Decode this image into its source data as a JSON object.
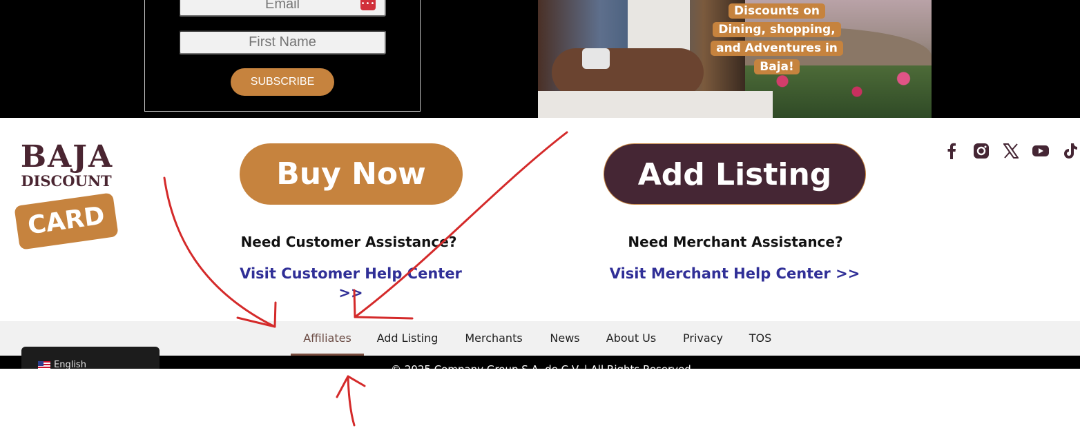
{
  "subscribe": {
    "email_placeholder": "Email",
    "first_name_placeholder": "First Name",
    "button_label": "SUBSCRIBE"
  },
  "promo": {
    "text": "Discounts on Dining, shopping, and Adventures in Baja!"
  },
  "logo": {
    "line1": "BAJA",
    "line2": "DISCOUNT",
    "line3": "CARD"
  },
  "cta": {
    "buy_now": "Buy Now",
    "add_listing": "Add Listing"
  },
  "assistance": {
    "customer_question": "Need Customer Assistance?",
    "customer_link": "Visit Customer Help Center >>",
    "merchant_question": "Need Merchant Assistance?",
    "merchant_link": "Visit Merchant Help Center >>"
  },
  "social": [
    "facebook-icon",
    "instagram-icon",
    "x-icon",
    "youtube-icon",
    "tiktok-icon"
  ],
  "footer_menu": {
    "items": [
      "Affiliates",
      "Add Listing",
      "Merchants",
      "News",
      "About Us",
      "Privacy",
      "TOS"
    ],
    "active": "Affiliates"
  },
  "copyright": "© 2025 Company Group S.A. de C.V. | All Rights Reserved",
  "language": {
    "label": "English"
  },
  "colors": {
    "brand_gold": "#c6833e",
    "brand_plum": "#452634",
    "link_blue": "#302f97",
    "annotation_red": "#d42a2a"
  }
}
